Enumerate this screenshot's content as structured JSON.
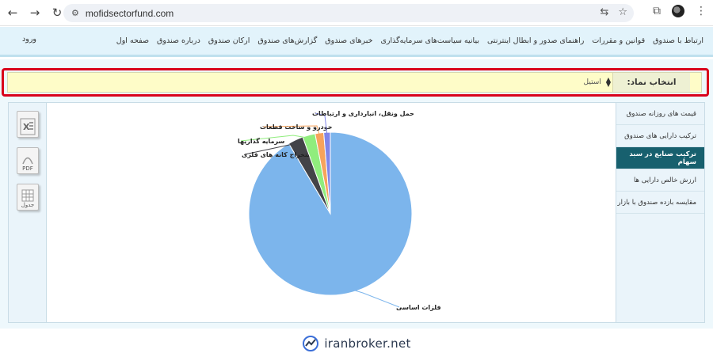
{
  "browser": {
    "url": "mofidsectorfund.com"
  },
  "header": {
    "menu": [
      "صفحه اول",
      "درباره صندوق",
      "ارکان صندوق",
      "گزارش‌های صندوق",
      "خبرهای صندوق",
      "بیانیه سیاست‌های سرمایه‌گذاری",
      "راهنمای صدور و ابطال اینترنتی",
      "قوانین و مقررات",
      "ارتباط با صندوق"
    ],
    "login": "ورود"
  },
  "selector": {
    "label": "انتخاب نماد:",
    "value": "استیل"
  },
  "tabs": [
    {
      "label": "قیمت های روزانه صندوق",
      "active": false
    },
    {
      "label": "ترکیب دارایی های صندوق",
      "active": false
    },
    {
      "label": "ترکیب صنایع در سبد سهام",
      "active": true
    },
    {
      "label": "ارزش خالص دارایی ها",
      "active": false
    },
    {
      "label": "مقایسه بازده صندوق با بازار",
      "active": false
    }
  ],
  "tools": [
    "excel-icon",
    "pdf-icon",
    "table-icon"
  ],
  "tool_labels": {
    "pdf": "PDF",
    "table": "جدول"
  },
  "chart_data": {
    "type": "pie",
    "slices": [
      {
        "label": "فلزات اساسی",
        "value": 91.5,
        "color": "#7cb5ec"
      },
      {
        "label": "استخراج کانه های فلزی",
        "value": 3.0,
        "color": "#434348"
      },
      {
        "label": "سرمایه گذاریها",
        "value": 2.5,
        "color": "#90ed7d"
      },
      {
        "label": "خودرو و ساخت قطعات",
        "value": 1.7,
        "color": "#f7a35c"
      },
      {
        "label": "حمل ونقل، انبارداری و ارتباطات",
        "value": 1.3,
        "color": "#8085e9"
      }
    ],
    "legend": "none"
  },
  "footer": {
    "brand": "iranbroker.net",
    "brand_color": "#2c3a50"
  }
}
